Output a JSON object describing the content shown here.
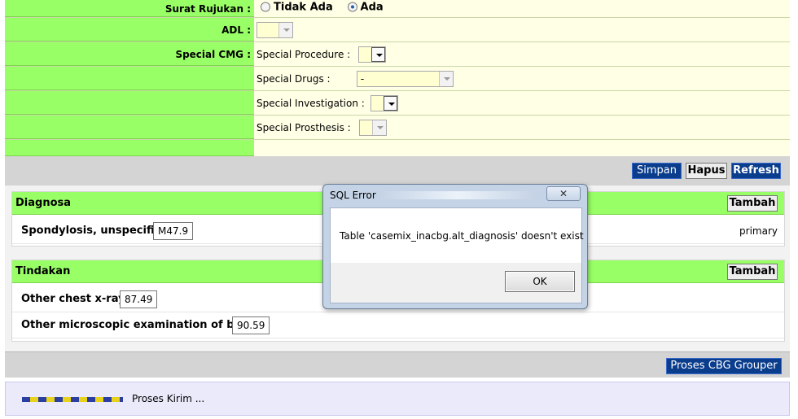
{
  "form": {
    "surat_rujukan": {
      "label": "Surat Rujukan :",
      "opt1": "Tidak Ada",
      "opt2": "Ada"
    },
    "adl": {
      "label": "ADL :",
      "value": ""
    },
    "special_cmg": {
      "label": "Special CMG :",
      "procedure_label": "Special Procedure :",
      "drugs_label": "Special Drugs :",
      "drugs_value": "-",
      "investigation_label": "Special Investigation :",
      "prosthesis_label": "Special Prosthesis :"
    }
  },
  "toolbar": {
    "simpan": "Simpan",
    "hapus": "Hapus",
    "refresh": "Refresh"
  },
  "diagnosa": {
    "title": "Diagnosa",
    "add_label": "Tambah",
    "items": [
      {
        "name": "Spondylosis, unspecified",
        "code": "M47.9",
        "role": "primary"
      }
    ]
  },
  "tindakan": {
    "title": "Tindakan",
    "add_label": "Tambah",
    "items": [
      {
        "name": "Other chest x-ray",
        "code": "87.49"
      },
      {
        "name": "Other microscopic examination of blood",
        "code": "90.59"
      }
    ]
  },
  "grouper": {
    "button": "Proses CBG Grouper"
  },
  "status": {
    "text": "Proses Kirim ..."
  },
  "dialog": {
    "title": "SQL Error",
    "message": "Table 'casemix_inacbg.alt_diagnosis' doesn't exist",
    "ok_label": "OK"
  }
}
